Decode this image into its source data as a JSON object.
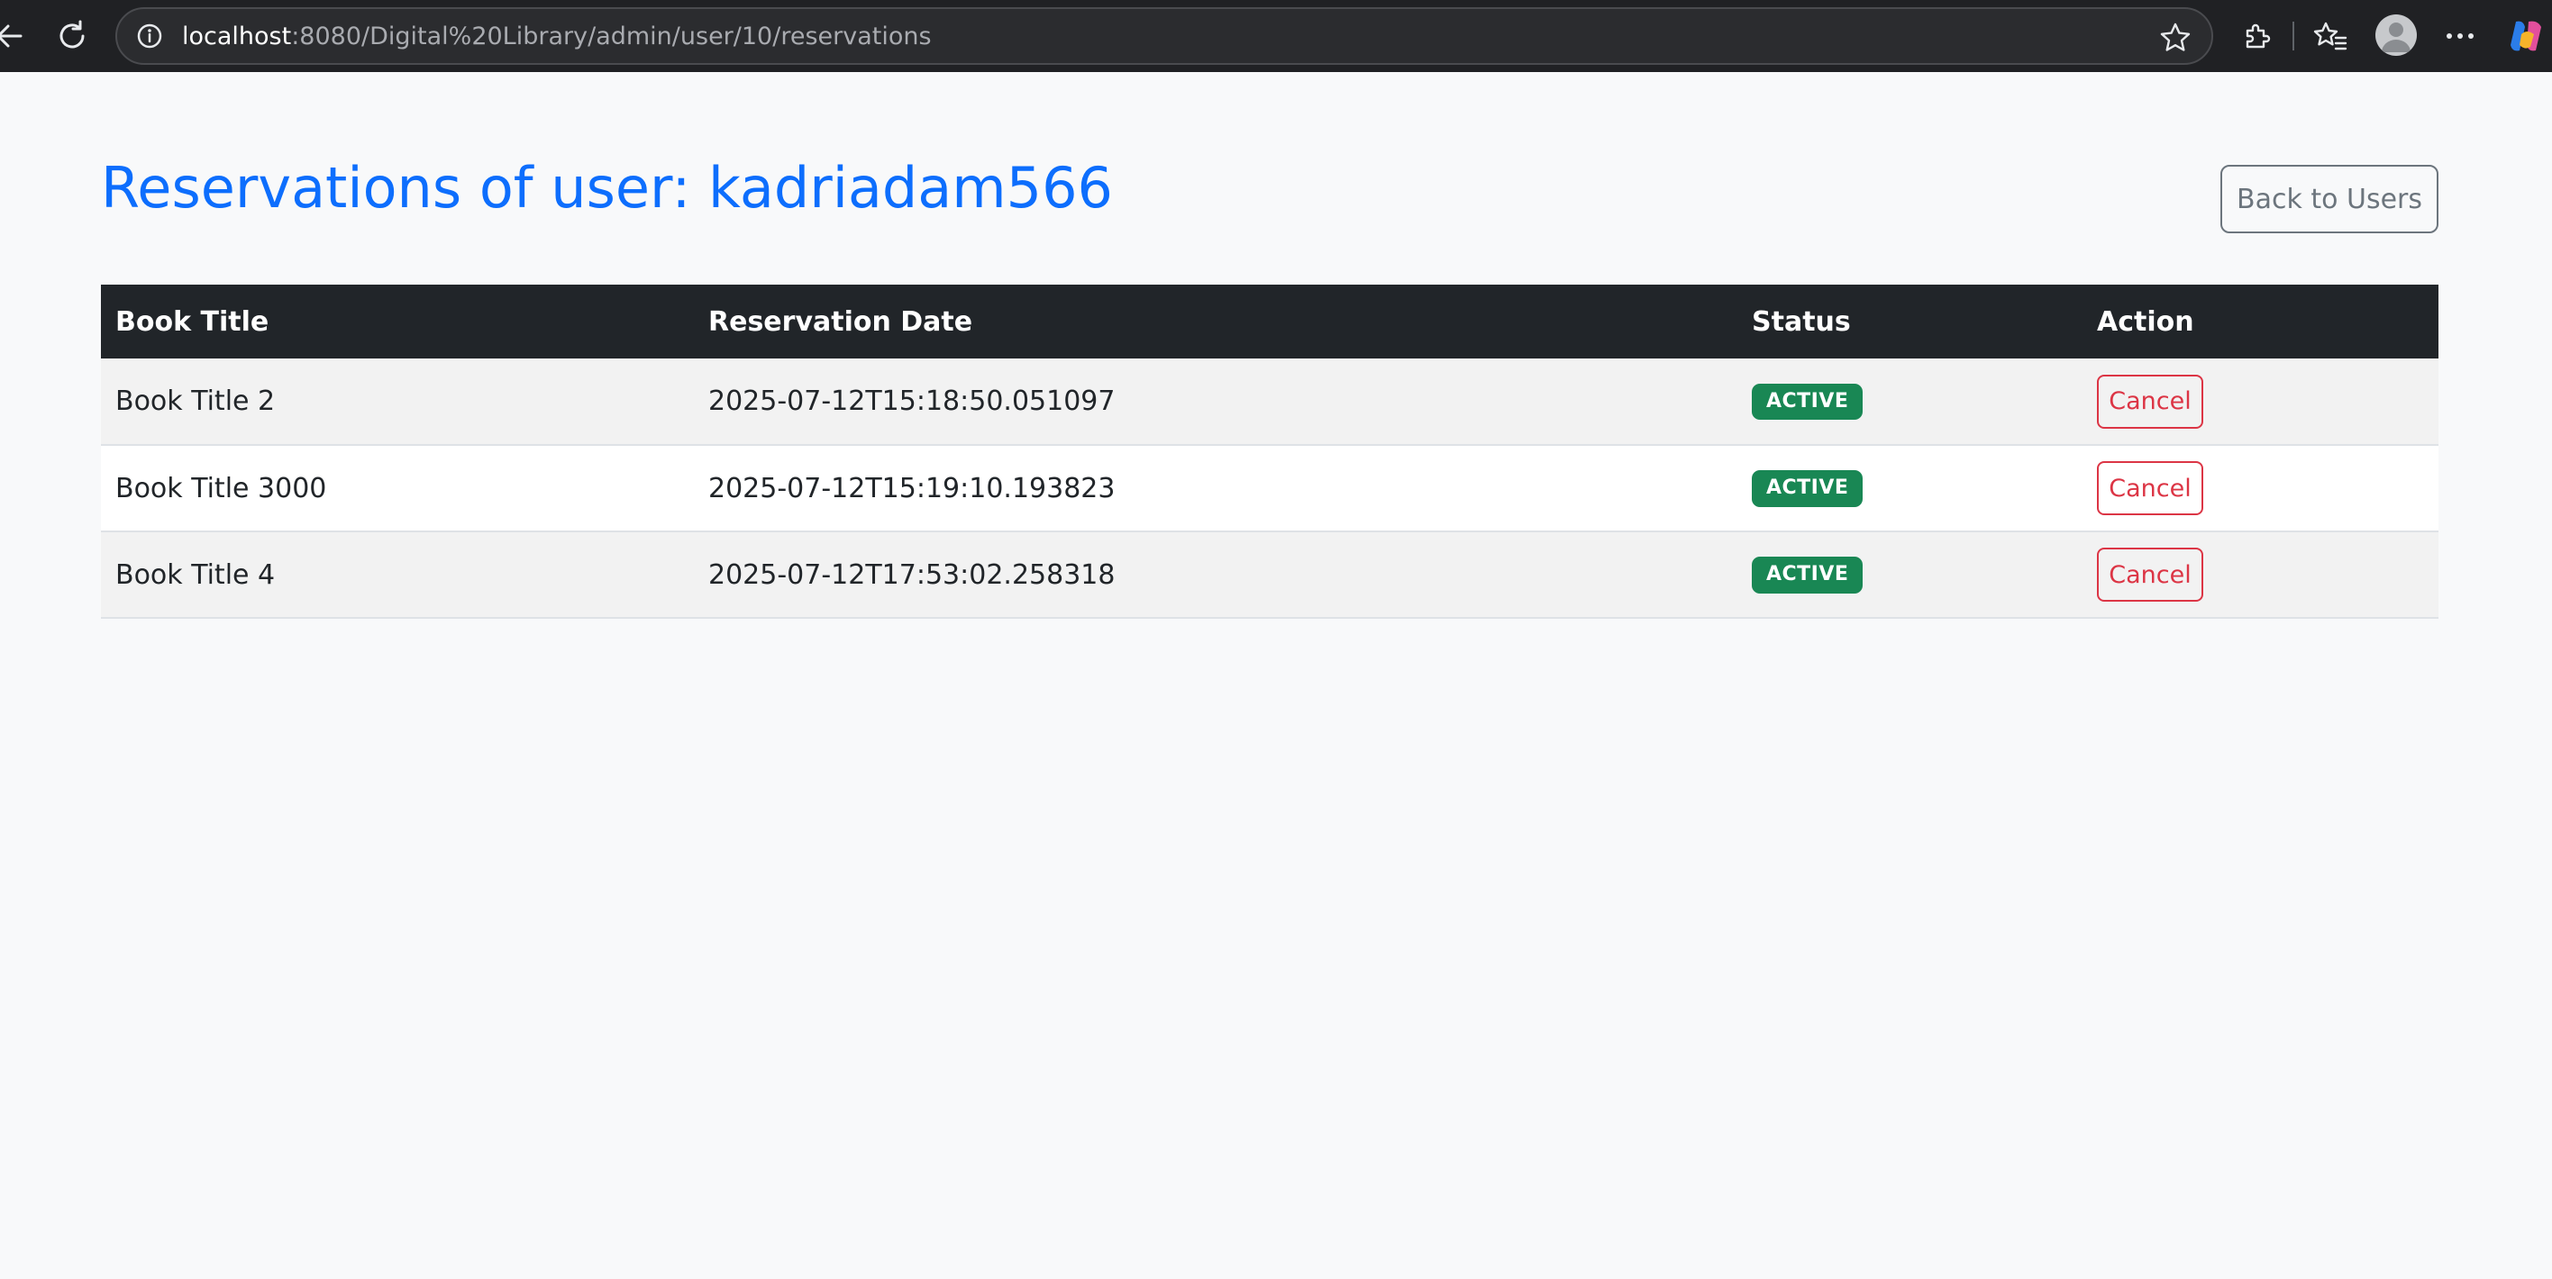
{
  "browser": {
    "url_host": "localhost",
    "url_path": ":8080/Digital%20Library/admin/user/10/reservations",
    "icons": [
      "back-arrow-icon",
      "reload-icon",
      "info-icon",
      "star-icon",
      "extensions-icon",
      "favorites-icon",
      "profile-avatar-icon",
      "more-icon",
      "copilot-icon"
    ]
  },
  "page": {
    "title": "Reservations of user: kadriadam566",
    "back_button": "Back to Users"
  },
  "table": {
    "headers": [
      "Book Title",
      "Reservation Date",
      "Status",
      "Action"
    ],
    "rows": [
      {
        "title": "Book Title 2",
        "date": "2025-07-12T15:18:50.051097",
        "status": "ACTIVE",
        "action": "Cancel"
      },
      {
        "title": "Book Title 3000",
        "date": "2025-07-12T15:19:10.193823",
        "status": "ACTIVE",
        "action": "Cancel"
      },
      {
        "title": "Book Title 4",
        "date": "2025-07-12T17:53:02.258318",
        "status": "ACTIVE",
        "action": "Cancel"
      }
    ]
  },
  "colors": {
    "title": "#0d6efd",
    "table_header": "#212529",
    "badge_active": "#198754",
    "cancel": "#dc3545",
    "secondary": "#6c757d"
  }
}
